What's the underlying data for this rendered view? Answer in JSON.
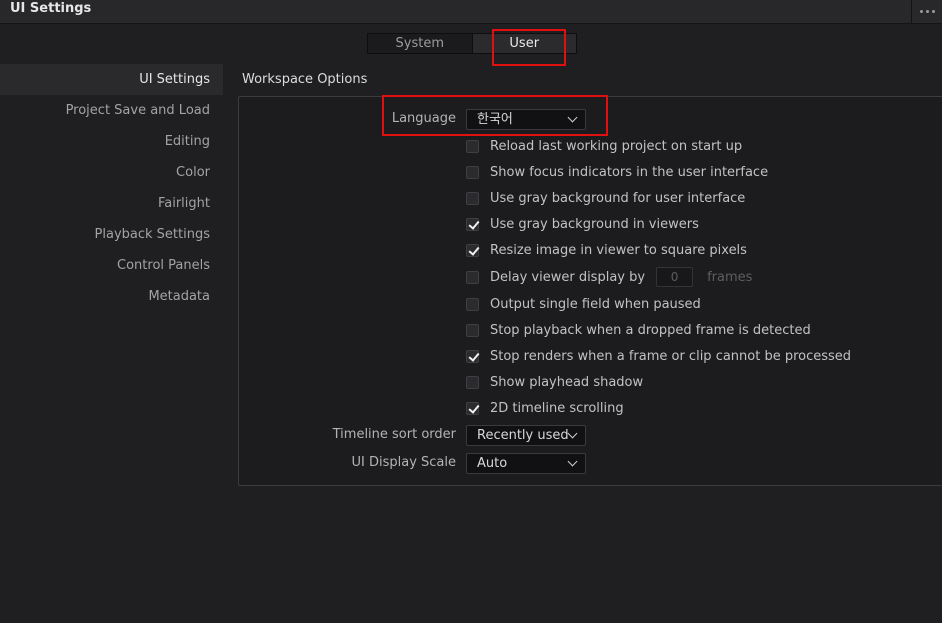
{
  "window": {
    "title": "UI Settings",
    "more_icon": "more-dots-icon"
  },
  "tabs": [
    {
      "label": "System",
      "active": false
    },
    {
      "label": "User",
      "active": true
    }
  ],
  "sidebar": {
    "items": [
      {
        "label": "UI Settings",
        "active": true
      },
      {
        "label": "Project Save and Load",
        "active": false
      },
      {
        "label": "Editing",
        "active": false
      },
      {
        "label": "Color",
        "active": false
      },
      {
        "label": "Fairlight",
        "active": false
      },
      {
        "label": "Playback Settings",
        "active": false
      },
      {
        "label": "Control Panels",
        "active": false
      },
      {
        "label": "Metadata",
        "active": false
      }
    ]
  },
  "workspace": {
    "title": "Workspace Options",
    "language": {
      "label": "Language",
      "value": "한국어"
    },
    "options": [
      {
        "label": "Reload last working project on start up",
        "checked": false
      },
      {
        "label": "Show focus indicators in the user interface",
        "checked": false
      },
      {
        "label": "Use gray background for user interface",
        "checked": false
      },
      {
        "label": "Use gray background in viewers",
        "checked": true
      },
      {
        "label": "Resize image in viewer to square pixels",
        "checked": true
      },
      {
        "label": "Delay viewer display by",
        "checked": false
      },
      {
        "label": "Output single field when paused",
        "checked": false
      },
      {
        "label": "Stop playback when a dropped frame is detected",
        "checked": false
      },
      {
        "label": "Stop renders when a frame or clip cannot be processed",
        "checked": true
      },
      {
        "label": "Show playhead shadow",
        "checked": false
      },
      {
        "label": "2D timeline scrolling",
        "checked": true
      }
    ],
    "delay": {
      "value": "0",
      "unit": "frames"
    },
    "timeline_sort": {
      "label": "Timeline sort order",
      "value": "Recently used"
    },
    "display_scale": {
      "label": "UI Display Scale",
      "value": "Auto"
    }
  },
  "colors": {
    "highlight": "#e01010",
    "background": "#1f1f22",
    "active_item": "#2a2a2d"
  }
}
